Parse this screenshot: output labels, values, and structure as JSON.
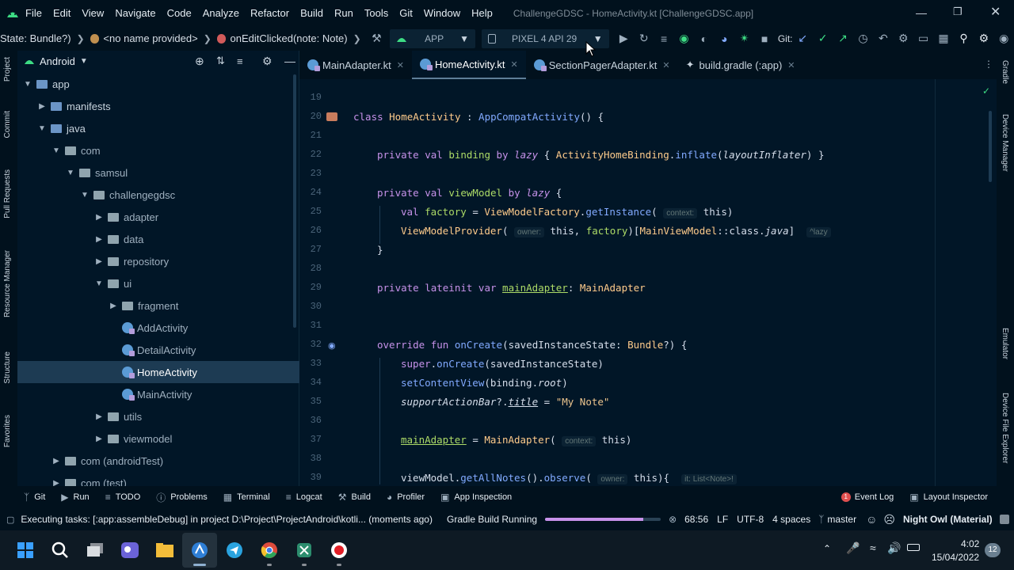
{
  "menubar": {
    "items": [
      "File",
      "Edit",
      "View",
      "Navigate",
      "Code",
      "Analyze",
      "Refactor",
      "Build",
      "Run",
      "Tools",
      "Git",
      "Window",
      "Help"
    ],
    "window_title": "ChallengeGDSC - HomeActivity.kt [ChallengeGDSC.app]"
  },
  "navbar": {
    "crumbs": [
      "State: Bundle?)",
      "<no name provided>",
      "onEditClicked(note: Note)"
    ],
    "run_config": "APP",
    "device": "PIXEL 4 API 29",
    "git_label": "Git:"
  },
  "left_tools": [
    "Project",
    "Commit",
    "Pull Requests",
    "Resource Manager",
    "Structure",
    "Favorites"
  ],
  "right_tools": [
    "Gradle",
    "Device Manager",
    "Emulator",
    "Device File Explorer"
  ],
  "project_panel": {
    "view_select": "Android",
    "tree": [
      {
        "label": "app",
        "level": 0,
        "kind": "module",
        "open": true
      },
      {
        "label": "manifests",
        "level": 1,
        "kind": "folder",
        "open": false
      },
      {
        "label": "java",
        "level": 1,
        "kind": "folder",
        "open": true
      },
      {
        "label": "com",
        "level": 2,
        "kind": "folder",
        "open": true
      },
      {
        "label": "samsul",
        "level": 3,
        "kind": "folder",
        "open": true
      },
      {
        "label": "challengegdsc",
        "level": 4,
        "kind": "folder",
        "open": true
      },
      {
        "label": "adapter",
        "level": 5,
        "kind": "folder",
        "open": false
      },
      {
        "label": "data",
        "level": 5,
        "kind": "folder",
        "open": false
      },
      {
        "label": "repository",
        "level": 5,
        "kind": "folder",
        "open": false
      },
      {
        "label": "ui",
        "level": 5,
        "kind": "folder",
        "open": true
      },
      {
        "label": "fragment",
        "level": 6,
        "kind": "folder",
        "open": false
      },
      {
        "label": "AddActivity",
        "level": 6,
        "kind": "kotlin"
      },
      {
        "label": "DetailActivity",
        "level": 6,
        "kind": "kotlin"
      },
      {
        "label": "HomeActivity",
        "level": 6,
        "kind": "kotlin",
        "selected": true
      },
      {
        "label": "MainActivity",
        "level": 6,
        "kind": "kotlin"
      },
      {
        "label": "utils",
        "level": 5,
        "kind": "folder",
        "open": false
      },
      {
        "label": "viewmodel",
        "level": 5,
        "kind": "folder",
        "open": false
      },
      {
        "label": "com (androidTest)",
        "level": 2,
        "kind": "folder",
        "open": false
      },
      {
        "label": "com (test)",
        "level": 2,
        "kind": "folder",
        "open": false
      }
    ]
  },
  "editor_tabs": [
    {
      "label": "MainAdapter.kt",
      "active": false
    },
    {
      "label": "HomeActivity.kt",
      "active": true
    },
    {
      "label": "SectionPagerAdapter.kt",
      "active": false
    },
    {
      "label": "build.gradle (:app)",
      "active": false
    }
  ],
  "code_lines": [
    "19",
    "20",
    "21",
    "22",
    "23",
    "24",
    "25",
    "26",
    "27",
    "28",
    "29",
    "30",
    "31",
    "32",
    "33",
    "34",
    "35",
    "36",
    "37",
    "38",
    "39"
  ],
  "code": {
    "l20": [
      "class ",
      "HomeActivity",
      " : ",
      "AppCompatActivity",
      "() {"
    ],
    "l22": [
      "private val ",
      "binding",
      " by ",
      "lazy",
      " { ",
      "ActivityHomeBinding",
      ".",
      "inflate",
      "(",
      "layoutInflater",
      ") }"
    ],
    "l24": [
      "private val ",
      "viewModel",
      " by ",
      "lazy",
      " {"
    ],
    "l25": [
      "val ",
      "factory",
      " = ",
      "ViewModelFactory",
      ".",
      "getInstance",
      "( ",
      "context:",
      " this)"
    ],
    "l26": [
      "ViewModelProvider",
      "( ",
      "owner:",
      " this, ",
      "factory",
      ")[",
      "MainViewModel",
      "::class.",
      "java",
      "]  ",
      "^lazy"
    ],
    "l27": [
      "}"
    ],
    "l29": [
      "private lateinit var ",
      "mainAdapter",
      ": ",
      "MainAdapter"
    ],
    "l32": [
      "override fun ",
      "onCreate",
      "(savedInstanceState: ",
      "Bundle",
      "?) {"
    ],
    "l33": [
      "super",
      ".",
      "onCreate",
      "(savedInstanceState)"
    ],
    "l34": [
      "setContentView",
      "(binding.",
      "root",
      ")"
    ],
    "l35": [
      "supportActionBar",
      "?.",
      "title",
      " = ",
      "\"My Note\""
    ],
    "l37": [
      "mainAdapter",
      " = ",
      "MainAdapter",
      "( ",
      "context:",
      " this)"
    ],
    "l39": [
      "viewModel",
      ".",
      "getAllNotes",
      "().",
      "observe",
      "( ",
      "owner:",
      " this){  ",
      "it: List<Note>!"
    ]
  },
  "tool_windows": [
    "Git",
    "Run",
    "TODO",
    "Problems",
    "Terminal",
    "Logcat",
    "Build",
    "Profiler",
    "App Inspection"
  ],
  "tool_windows_right": {
    "event_log": "Event Log",
    "event_badge": "1",
    "layout_inspector": "Layout Inspector"
  },
  "status": {
    "task": "Executing tasks: [:app:assembleDebug] in project D:\\Project\\ProjectAndroid\\kotli... (moments ago)",
    "gradle": "Gradle Build Running",
    "progress": 0.85,
    "position": "68:56",
    "line_sep": "LF",
    "encoding": "UTF-8",
    "indent": "4 spaces",
    "branch": "master",
    "theme": "Night Owl (Material)"
  },
  "taskbar": {
    "apps": [
      "start-icon",
      "search-icon",
      "task-view-icon",
      "chat-icon",
      "file-explorer-icon",
      "android-studio-icon",
      "telegram-icon",
      "chrome-icon",
      "snipping-icon",
      "recorder-icon"
    ],
    "time": "4:02",
    "date": "15/04/2022",
    "notif_count": "12"
  },
  "colors": {
    "accent": "#5f7e97",
    "bg": "#011627",
    "selection": "#1d3b53",
    "progress": "#c792ea"
  }
}
